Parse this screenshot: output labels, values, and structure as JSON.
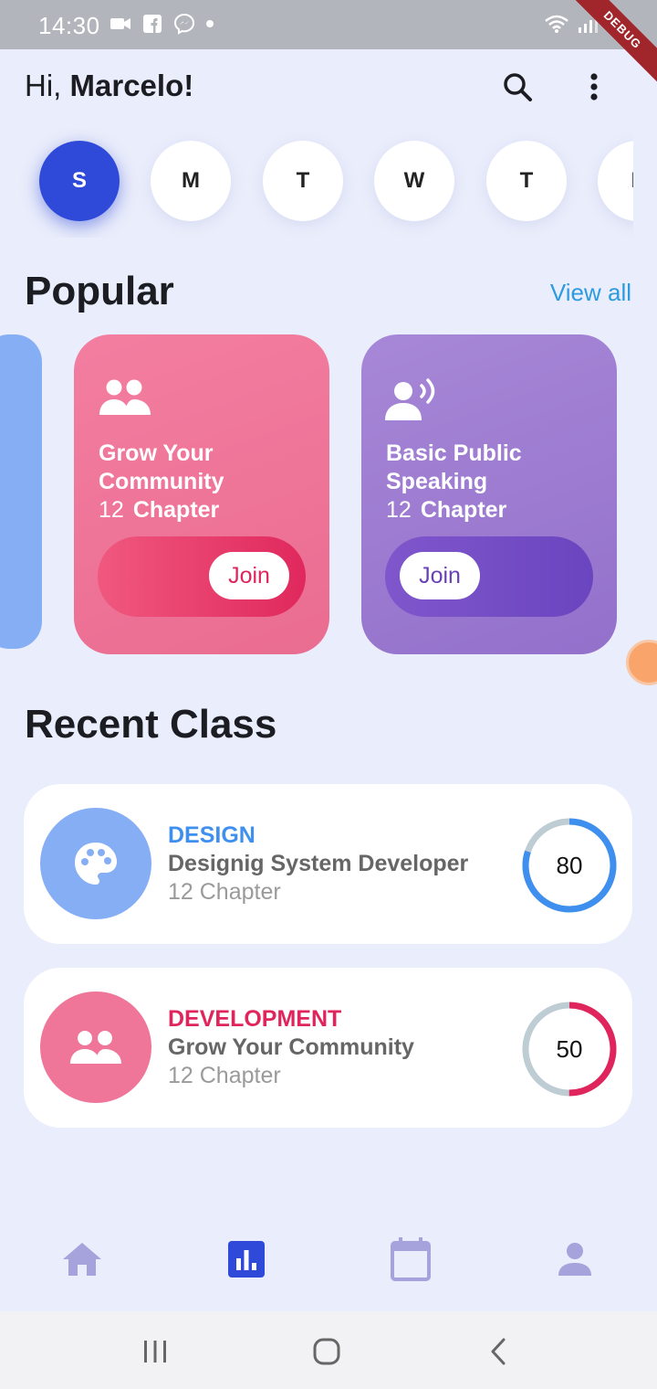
{
  "status_bar": {
    "time": "14:30",
    "debug_label": "DEBUG"
  },
  "header": {
    "greeting_prefix": "Hi,",
    "user_name": "Marcelo!"
  },
  "days": [
    "S",
    "M",
    "T",
    "W",
    "T",
    "F"
  ],
  "selected_day_index": 0,
  "popular": {
    "title": "Popular",
    "view_all": "View all",
    "cards": [
      {
        "title": "Grow Your Community",
        "chapter_count": "12",
        "chapter_label": "Chapter",
        "join_label": "Join",
        "color": "#ef7599",
        "icon": "group-icon"
      },
      {
        "title": "Basic Public Speaking",
        "chapter_count": "12",
        "chapter_label": "Chapter",
        "join_label": "Join",
        "color": "#9f81d3",
        "icon": "speaker-icon"
      }
    ]
  },
  "recent": {
    "title": "Recent Class",
    "items": [
      {
        "category": "DESIGN",
        "name": "Designig System Developer",
        "chapter": "12 Chapter",
        "progress": 80,
        "progress_label": "80",
        "color": "#3f8fef",
        "icon": "palette-icon"
      },
      {
        "category": "DEVELOPMENT",
        "name": "Grow Your Community",
        "chapter": "12 Chapter",
        "progress": 50,
        "progress_label": "50",
        "color": "#e0245c",
        "icon": "group-icon"
      }
    ]
  },
  "bottom_nav": [
    "home-icon",
    "stats-icon",
    "calendar-icon",
    "profile-icon"
  ],
  "bottom_nav_active": 1,
  "colors": {
    "primary": "#2f4ad8",
    "background": "#eaedfb",
    "link": "#2d9be0"
  }
}
